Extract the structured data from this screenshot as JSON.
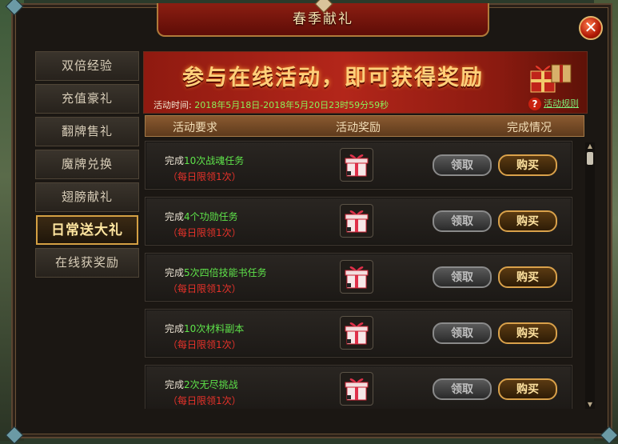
{
  "window": {
    "title": "春季献礼",
    "close_label": "✕"
  },
  "sidebar": {
    "items": [
      {
        "label": "双倍经验",
        "active": false
      },
      {
        "label": "充值豪礼",
        "active": false
      },
      {
        "label": "翻牌售礼",
        "active": false
      },
      {
        "label": "魔牌兑换",
        "active": false
      },
      {
        "label": "翅膀献礼",
        "active": false
      },
      {
        "label": "日常送大礼",
        "active": true
      },
      {
        "label": "在线获奖励",
        "active": false
      }
    ]
  },
  "banner": {
    "headline": "参与在线活动，即可获得奖励",
    "time_label": "活动时间:",
    "time_value": "2018年5月18日-2018年5月20日23时59分59秒",
    "rules_label": "活动规则"
  },
  "table": {
    "col_requirement": "活动要求",
    "col_reward": "活动奖励",
    "col_status": "完成情况"
  },
  "tasks": [
    {
      "prefix": "完成",
      "highlight": "10次战魂任务",
      "limit": "（每日限领1次）",
      "claim": "领取",
      "buy": "购买"
    },
    {
      "prefix": "完成",
      "highlight": "4个功勋任务",
      "limit": "（每日限领1次）",
      "claim": "领取",
      "buy": "购买"
    },
    {
      "prefix": "完成",
      "highlight": "5次四倍技能书任务",
      "limit": "（每日限领1次）",
      "claim": "领取",
      "buy": "购买"
    },
    {
      "prefix": "完成",
      "highlight": "10次材料副本",
      "limit": "（每日限领1次）",
      "claim": "领取",
      "buy": "购买"
    },
    {
      "prefix": "完成",
      "highlight": "2次无尽挑战",
      "limit": "（每日限领1次）",
      "claim": "领取",
      "buy": "购买"
    }
  ],
  "colors": {
    "accent_gold": "#d4a043",
    "highlight_green": "#5ee34a",
    "limit_red": "#e8322a",
    "banner_red": "#b3261a"
  },
  "icons": {
    "reward": "gift-box-icon",
    "close": "close-icon",
    "rules": "question-icon"
  }
}
